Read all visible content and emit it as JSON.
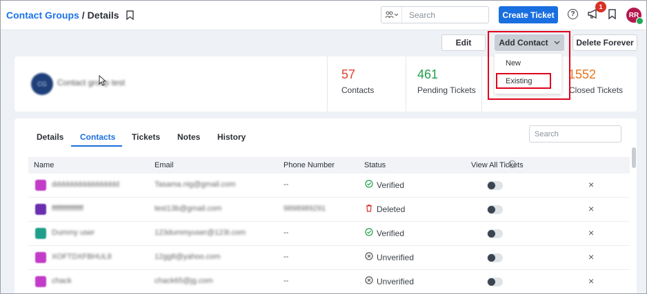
{
  "breadcrumb": {
    "parent": "Contact Groups",
    "separator": "/",
    "current": "Details"
  },
  "header": {
    "search_placeholder": "Search",
    "create_ticket_label": "Create Ticket",
    "help_glyph": "?",
    "notification_count": "1",
    "avatar_initials": "RR"
  },
  "actions": {
    "edit_label": "Edit",
    "add_contact_label": "Add Contact",
    "delete_label": "Delete Forever"
  },
  "dropdown": {
    "items": [
      {
        "label": "New"
      },
      {
        "label": "Existing"
      }
    ]
  },
  "group": {
    "avatar_text": "CG",
    "name": "Contact group test"
  },
  "stats": [
    {
      "value": "57",
      "label": "Contacts",
      "color": "#e0402a"
    },
    {
      "value": "461",
      "label": "Pending Tickets",
      "color": "#1e9e4a"
    },
    {
      "value": "",
      "label": "",
      "color": "#2b2f36"
    },
    {
      "value": "1552",
      "label": "Closed Tickets",
      "color": "#e8741e"
    }
  ],
  "tabs": [
    {
      "label": "Details",
      "active": false
    },
    {
      "label": "Contacts",
      "active": true
    },
    {
      "label": "Tickets",
      "active": false
    },
    {
      "label": "Notes",
      "active": false
    },
    {
      "label": "History",
      "active": false
    }
  ],
  "contacts_search_placeholder": "Search",
  "table": {
    "columns": [
      "Name",
      "Email",
      "Phone Number",
      "Status",
      "View All Tickets"
    ],
    "rows": [
      {
        "name": "dddddddddddddddd",
        "email": "Tasama.nig@gmail.com",
        "phone": "--",
        "status": "Verified",
        "status_icon": "check-circle-icon",
        "avatar_color": "#c23cc9"
      },
      {
        "name": "ffffffffffffffff",
        "email": "test13b@gmail.com",
        "phone": "9898989291",
        "status": "Deleted",
        "status_icon": "trash-icon",
        "avatar_color": "#6a2fb0"
      },
      {
        "name": "Dummy user",
        "email": "123dummyuser@123t.com",
        "phone": "--",
        "status": "Verified",
        "status_icon": "check-circle-icon",
        "avatar_color": "#1f9e8a"
      },
      {
        "name": "XOFTDXFBHUL8",
        "email": "12gg8@yahoo.com",
        "phone": "--",
        "status": "Unverified",
        "status_icon": "x-circle-icon",
        "avatar_color": "#c23cc9"
      },
      {
        "name": "chack",
        "email": "chack65@jg.com",
        "phone": "--",
        "status": "Unverified",
        "status_icon": "x-circle-icon",
        "avatar_color": "#c23cc9"
      }
    ]
  }
}
